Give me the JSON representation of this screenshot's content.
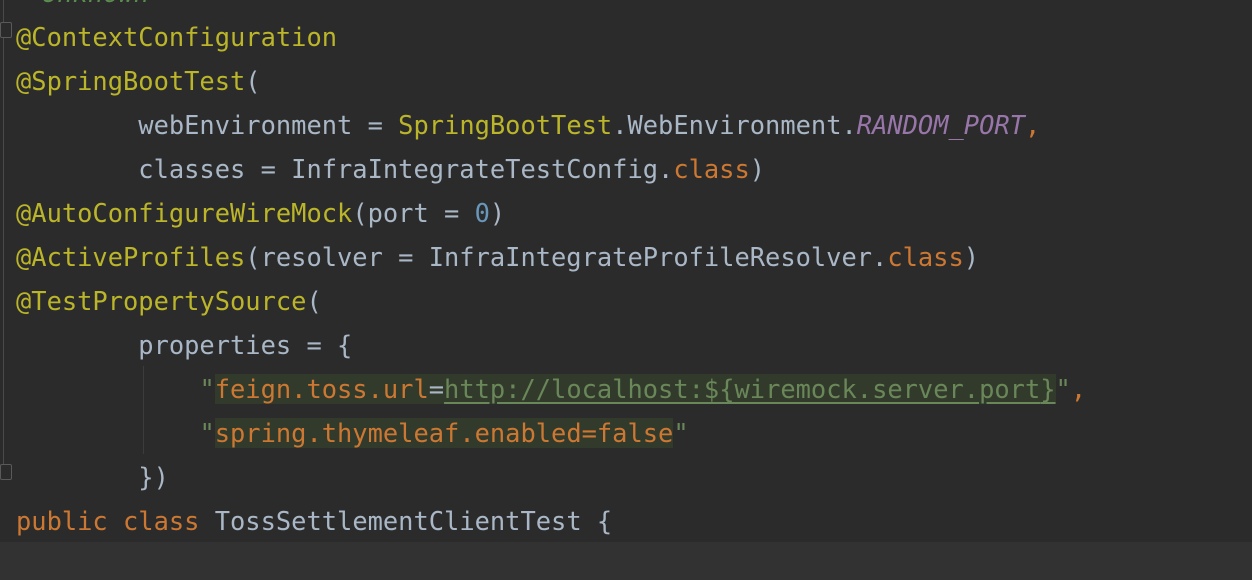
{
  "editor": {
    "top_fragment": "Unknown",
    "lines": [
      [
        {
          "t": "@ContextConfiguration",
          "c": "annot"
        }
      ],
      [
        {
          "t": "@SpringBootTest",
          "c": "annot"
        },
        {
          "t": "(",
          "c": "plain"
        }
      ],
      [
        {
          "t": "        webEnvironment = ",
          "c": "plain"
        },
        {
          "t": "SpringBootTest",
          "c": "annot"
        },
        {
          "t": ".WebEnvironment.",
          "c": "plain"
        },
        {
          "t": "RANDOM_PORT",
          "c": "const"
        },
        {
          "t": ",",
          "c": "kw"
        }
      ],
      [
        {
          "t": "        classes = InfraIntegrateTestConfig.",
          "c": "plain"
        },
        {
          "t": "class",
          "c": "kw"
        },
        {
          "t": ")",
          "c": "plain"
        }
      ],
      [
        {
          "t": "@AutoConfigureWireMock",
          "c": "annot"
        },
        {
          "t": "(port = ",
          "c": "plain"
        },
        {
          "t": "0",
          "c": "num"
        },
        {
          "t": ")",
          "c": "plain"
        }
      ],
      [
        {
          "t": "@ActiveProfiles",
          "c": "annot"
        },
        {
          "t": "(resolver = InfraIntegrateProfileResolver.",
          "c": "plain"
        },
        {
          "t": "class",
          "c": "kw"
        },
        {
          "t": ")",
          "c": "plain"
        }
      ],
      [
        {
          "t": "@TestPropertySource",
          "c": "annot"
        },
        {
          "t": "(",
          "c": "plain"
        }
      ],
      [
        {
          "t": "        properties = {",
          "c": "plain"
        }
      ],
      [
        {
          "t": "            ",
          "c": "plain"
        },
        {
          "t": "\"",
          "c": "str"
        },
        {
          "t": "feign.toss.url",
          "c": "inj"
        },
        {
          "t": "=",
          "c": "injbg"
        },
        {
          "t": "http://localhost:${",
          "c": "inj-link"
        },
        {
          "t": "wiremock.server.port",
          "c": "inj-link"
        },
        {
          "t": "}",
          "c": "inj-link"
        },
        {
          "t": "\"",
          "c": "str"
        },
        {
          "t": ",",
          "c": "kw"
        }
      ],
      [
        {
          "t": "            ",
          "c": "plain"
        },
        {
          "t": "\"",
          "c": "str"
        },
        {
          "t": "spring.thymeleaf.enabled=false",
          "c": "inj"
        },
        {
          "t": "\"",
          "c": "str"
        }
      ],
      [
        {
          "t": "        })",
          "c": "plain"
        }
      ],
      [
        {
          "t": "public",
          "c": "kw"
        },
        {
          "t": " ",
          "c": "plain"
        },
        {
          "t": "class",
          "c": "kw"
        },
        {
          "t": " TossSettlementClientTest {",
          "c": "plain"
        }
      ]
    ]
  },
  "colors": {
    "background": "#2b2b2b",
    "annotation": "#bbb529",
    "keyword": "#cc7832",
    "number": "#6897bb",
    "constant": "#9876aa",
    "string": "#6a8759",
    "plain": "#a9b7c6",
    "injection_bg": "#323a2c"
  }
}
